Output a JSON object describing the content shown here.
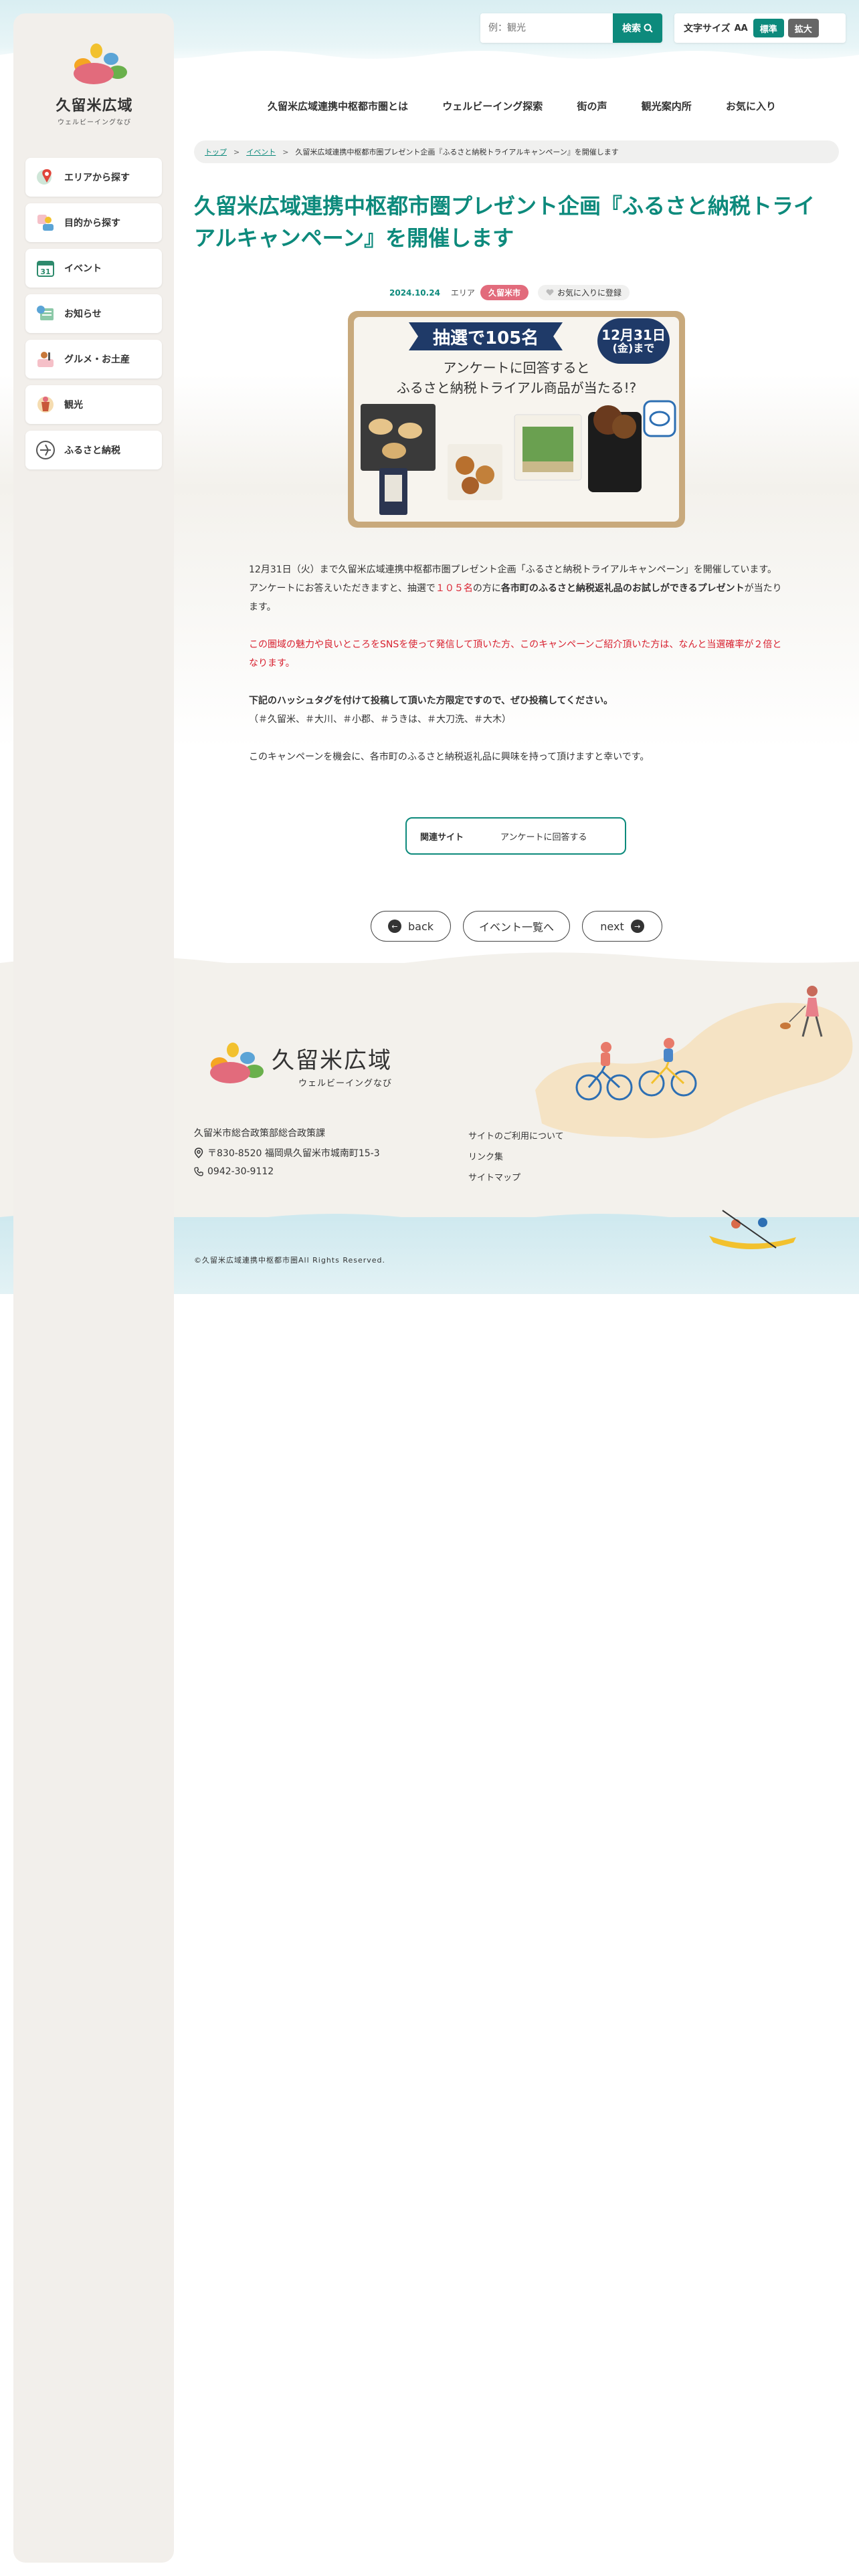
{
  "site": {
    "name": "久留米広域",
    "tagline": "ウェルビーイングなび"
  },
  "sidebar": {
    "items": [
      {
        "label": "エリアから探す",
        "icon": "map-pin-icon"
      },
      {
        "label": "目的から探す",
        "icon": "people-icon"
      },
      {
        "label": "イベント",
        "icon": "calendar-icon"
      },
      {
        "label": "お知らせ",
        "icon": "news-icon"
      },
      {
        "label": "グルメ・お土産",
        "icon": "gourmet-icon"
      },
      {
        "label": "観光",
        "icon": "sightseeing-icon"
      },
      {
        "label": "ふるさと納税",
        "icon": "furusato-icon"
      }
    ]
  },
  "header": {
    "search_placeholder": "例：観光",
    "search_button": "検索",
    "fontsize_label": "文字サイズ",
    "fontsize_glyph": "AA",
    "fontsize_standard": "標準",
    "fontsize_large": "拡大",
    "nav": [
      "久留米広域連携中枢都市圏とは",
      "ウェルビーイング探索",
      "街の声",
      "観光案内所",
      "お気に入り"
    ]
  },
  "breadcrumb": {
    "home": "トップ",
    "category": "イベント",
    "current": "久留米広域連携中枢都市圏プレゼント企画『ふるさと納税トライアルキャンペーン』を開催します",
    "sep": ">"
  },
  "article": {
    "title": "久留米広域連携中枢都市圏プレゼント企画『ふるさと納税トライアルキャンペーン』を開催します",
    "date": "2024.10.24",
    "area_label": "エリア",
    "area_tag": "久留米市",
    "favorite_label": "お気に入りに登録",
    "hero": {
      "banner": "抽選で105名",
      "deadline_date": "12月31日",
      "deadline_sub": "(金)まで",
      "line1": "アンケートに回答すると",
      "line2": "ふるさと納税トライアル商品が当たる!?"
    },
    "p1_a": "12月31日（火）まで久留米広域連携中枢都市圏プレゼント企画「ふるさと納税トライアルキャンペーン」を開催しています。",
    "p1_b": "アンケートにお答えいただきますと、抽選で",
    "p1_red": "１０５名",
    "p1_c": "の方に",
    "p1_bold": "各市町のふるさと納税返礼品のお試しができるプレゼント",
    "p1_d": "が当たります。",
    "p2": "この圏域の魅力や良いところをSNSを使って発信して頂いた方、このキャンペーンご紹介頂いた方は、なんと当選確率が２倍となります。",
    "p3_bold": "下記のハッシュタグを付けて投稿して頂いた方限定ですので、ぜひ投稿してください。",
    "p3_tags": "（＃久留米、＃大川、＃小郡、＃うきは、＃大刀洗、＃大木）",
    "p4": "このキャンペーンを機会に、各市町のふるさと納税返礼品に興味を持って頂けますと幸いです。",
    "related_label": "関連サイト",
    "related_link": "アンケートに回答する"
  },
  "pager": {
    "back": "back",
    "list": "イベント一覧へ",
    "next": "next"
  },
  "footer": {
    "org": "久留米市総合政策部総合政策課",
    "address": "〒830-8520 福岡県久留米市城南町15-3",
    "tel": "0942-30-9112",
    "links": [
      "サイトのご利用について",
      "リンク集",
      "サイトマップ"
    ],
    "copyright": "©久留米広域連携中枢都市圏All Rights Reserved."
  },
  "colors": {
    "accent": "#0d8a7c",
    "emphasis_red": "#d8202f",
    "area_tag": "#e26b7c"
  }
}
